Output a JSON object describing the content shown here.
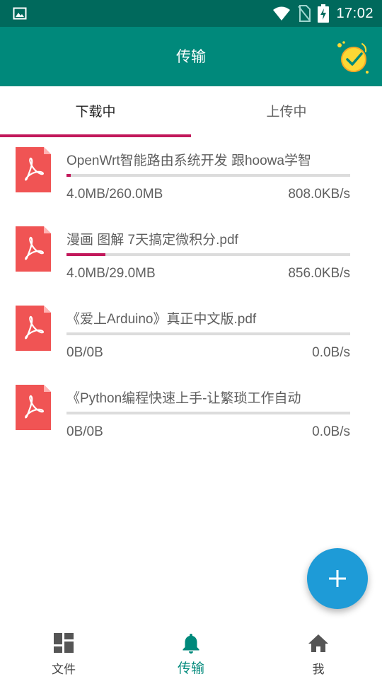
{
  "status_bar": {
    "time": "17:02"
  },
  "app_bar": {
    "title": "传输"
  },
  "tabs": [
    {
      "label": "下载中",
      "active": true
    },
    {
      "label": "上传中",
      "active": false
    }
  ],
  "downloads": [
    {
      "name": "OpenWrt智能路由系统开发 跟hoowa学智",
      "size": "4.0MB/260.0MB",
      "speed": "808.0KB/s",
      "progress": 0.015
    },
    {
      "name": "漫画 图解 7天搞定微积分.pdf",
      "size": "4.0MB/29.0MB",
      "speed": "856.0KB/s",
      "progress": 0.138
    },
    {
      "name": "《爱上Arduino》真正中文版.pdf",
      "size": "0B/0B",
      "speed": "0.0B/s",
      "progress": 0
    },
    {
      "name": "《Python编程快速上手-让繁琐工作自动",
      "size": "0B/0B",
      "speed": "0.0B/s",
      "progress": 0
    }
  ],
  "bottom_nav": [
    {
      "label": "文件",
      "icon": "dashboard-icon",
      "active": false
    },
    {
      "label": "传输",
      "icon": "bell-icon",
      "active": true
    },
    {
      "label": "我",
      "icon": "home-icon",
      "active": false
    }
  ],
  "colors": {
    "primary": "#00897b",
    "primary_dark": "#00695c",
    "accent": "#c2185b",
    "fab": "#1e9bd7",
    "pdf": "#f05454"
  }
}
